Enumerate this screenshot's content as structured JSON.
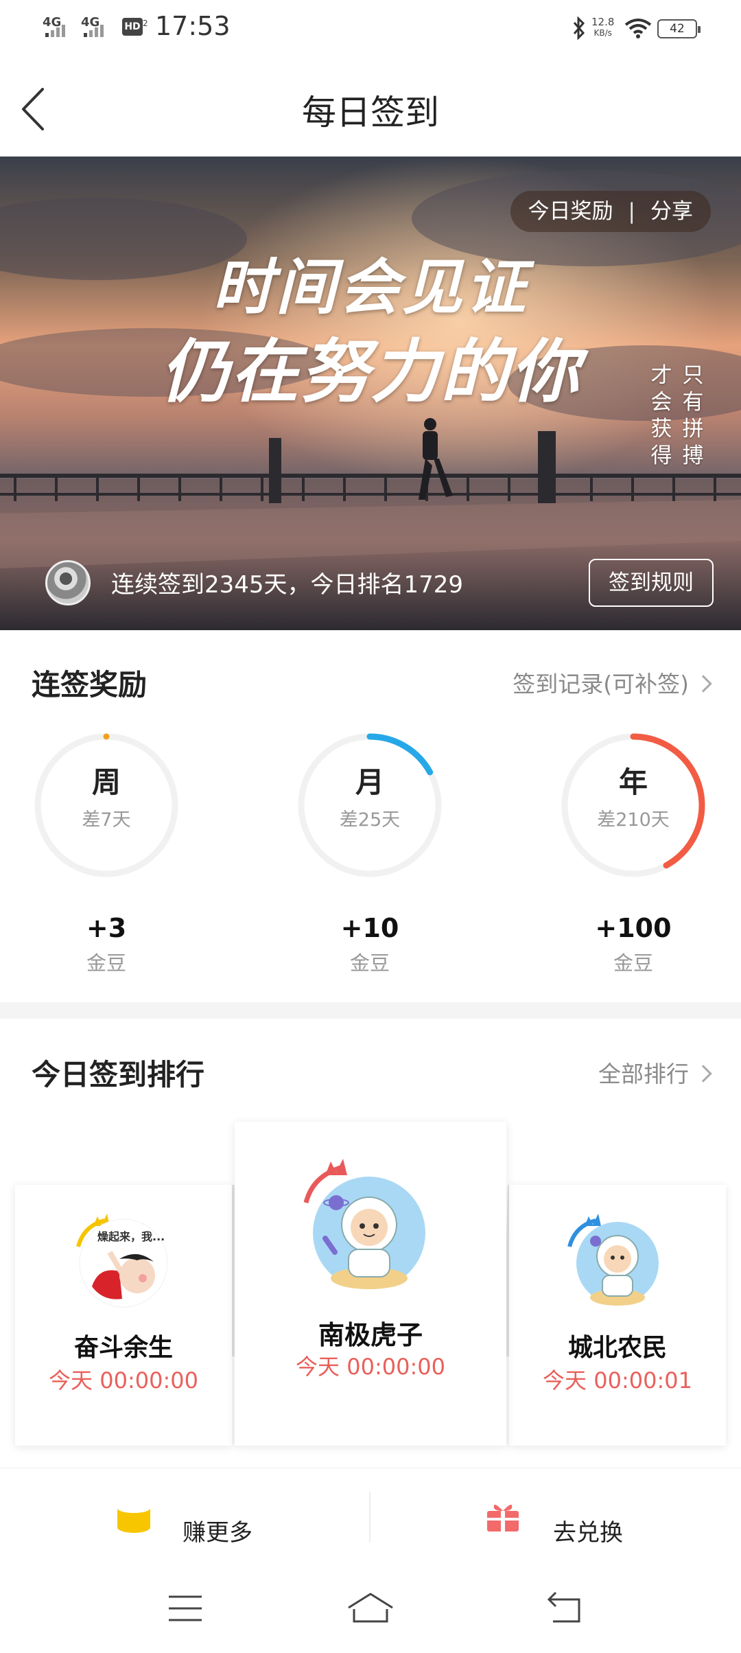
{
  "status_bar": {
    "signal_1": "4G",
    "signal_2": "4G",
    "hd_label": "HD",
    "hd_sub": "2",
    "time": "17:53",
    "net_speed_value": "12.8",
    "net_speed_unit": "KB/s",
    "battery": "42"
  },
  "header": {
    "title": "每日签到"
  },
  "banner": {
    "reward_label": "今日奖励",
    "separator": "|",
    "share_label": "分享",
    "quote_line1": "时间会见证",
    "quote_line2": "仍在努力的你",
    "vertical_right": "只有拼搏",
    "vertical_left": "才会获得",
    "streak_text": "连续签到2345天，今日排名1729",
    "rules_label": "签到规则"
  },
  "streak_rewards": {
    "title": "连签奖励",
    "link": "签到记录(可补签)",
    "items": [
      {
        "period": "周",
        "remaining": "差7天",
        "reward": "+3",
        "unit": "金豆",
        "progress": 0.0,
        "color": "#f0a020"
      },
      {
        "period": "月",
        "remaining": "差25天",
        "reward": "+10",
        "unit": "金豆",
        "progress": 0.17,
        "color": "#26a8e8"
      },
      {
        "period": "年",
        "remaining": "差210天",
        "reward": "+100",
        "unit": "金豆",
        "progress": 0.42,
        "color": "#f25c44"
      }
    ]
  },
  "ranking": {
    "title": "今日签到排行",
    "link": "全部排行",
    "entries": [
      {
        "rank": 2,
        "name": "奋斗余生",
        "time": "今天 00:00:00",
        "avatar_caption": "燥起来，我..."
      },
      {
        "rank": 1,
        "name": "南极虎子",
        "time": "今天 00:00:00"
      },
      {
        "rank": 3,
        "name": "城北农民",
        "time": "今天 00:00:01"
      }
    ]
  },
  "bottom_actions": {
    "earn_label": "赚更多",
    "redeem_label": "去兑换",
    "earn_color": "#f7c600",
    "redeem_color": "#f26a6a"
  },
  "nav_bar": {
    "menu": "menu-icon",
    "home": "home-icon",
    "back": "back-icon"
  }
}
